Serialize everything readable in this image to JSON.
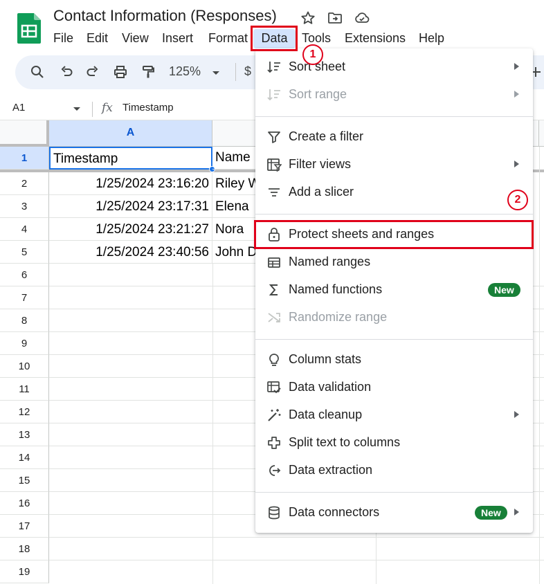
{
  "header": {
    "title": "Contact Information (Responses)",
    "menu": [
      "File",
      "Edit",
      "View",
      "Insert",
      "Format",
      "Data",
      "Tools",
      "Extensions",
      "Help"
    ]
  },
  "toolbar": {
    "zoom": "125%",
    "currency": "$"
  },
  "formula_bar": {
    "name_box": "A1",
    "fx": "fx",
    "content": "Timestamp"
  },
  "grid": {
    "column_header_a": "A",
    "header_row_num": "1",
    "header_cells": [
      "Timestamp",
      "Name"
    ],
    "rows": [
      {
        "num": "2",
        "timestamp": "1/25/2024 23:16:20",
        "name": "Riley W"
      },
      {
        "num": "3",
        "timestamp": "1/25/2024 23:17:31",
        "name": "Elena"
      },
      {
        "num": "4",
        "timestamp": "1/25/2024 23:21:27",
        "name": "Nora"
      },
      {
        "num": "5",
        "timestamp": "1/25/2024 23:40:56",
        "name": "John D"
      }
    ],
    "empty_rows": [
      "6",
      "7",
      "8",
      "9",
      "10",
      "11",
      "12",
      "13",
      "14",
      "15",
      "16",
      "17",
      "18",
      "19"
    ]
  },
  "data_menu": {
    "items": [
      {
        "label": "Sort sheet",
        "icon": "sort-icon",
        "submenu": true,
        "disabled": false
      },
      {
        "label": "Sort range",
        "icon": "sort-icon",
        "submenu": true,
        "disabled": true
      },
      {
        "label": "Create a filter",
        "icon": "filter-icon",
        "submenu": false,
        "disabled": false
      },
      {
        "label": "Filter views",
        "icon": "filter-views-icon",
        "submenu": true,
        "disabled": false
      },
      {
        "label": "Add a slicer",
        "icon": "slicer-icon",
        "submenu": false,
        "disabled": false
      },
      {
        "label": "Protect sheets and ranges",
        "icon": "lock-icon",
        "submenu": false,
        "disabled": false
      },
      {
        "label": "Named ranges",
        "icon": "named-ranges-icon",
        "submenu": false,
        "disabled": false
      },
      {
        "label": "Named functions",
        "icon": "sigma-icon",
        "submenu": false,
        "disabled": false,
        "badge": "New"
      },
      {
        "label": "Randomize range",
        "icon": "shuffle-icon",
        "submenu": false,
        "disabled": true
      },
      {
        "label": "Column stats",
        "icon": "lightbulb-icon",
        "submenu": false,
        "disabled": false
      },
      {
        "label": "Data validation",
        "icon": "data-validation-icon",
        "submenu": false,
        "disabled": false
      },
      {
        "label": "Data cleanup",
        "icon": "magic-wand-icon",
        "submenu": true,
        "disabled": false
      },
      {
        "label": "Split text to columns",
        "icon": "split-icon",
        "submenu": false,
        "disabled": false
      },
      {
        "label": "Data extraction",
        "icon": "extraction-icon",
        "submenu": false,
        "disabled": false
      },
      {
        "label": "Data connectors",
        "icon": "database-icon",
        "submenu": true,
        "disabled": false,
        "badge": "New"
      }
    ]
  },
  "annotations": {
    "step1": "1",
    "step2": "2",
    "color": "#e0001a"
  },
  "colors": {
    "accent_blue": "#1a73e8",
    "selected_header": "#d3e3fd",
    "toolbar_bg": "#edf2fa",
    "new_badge": "#188038",
    "sheets_green": "#0f9d58"
  }
}
